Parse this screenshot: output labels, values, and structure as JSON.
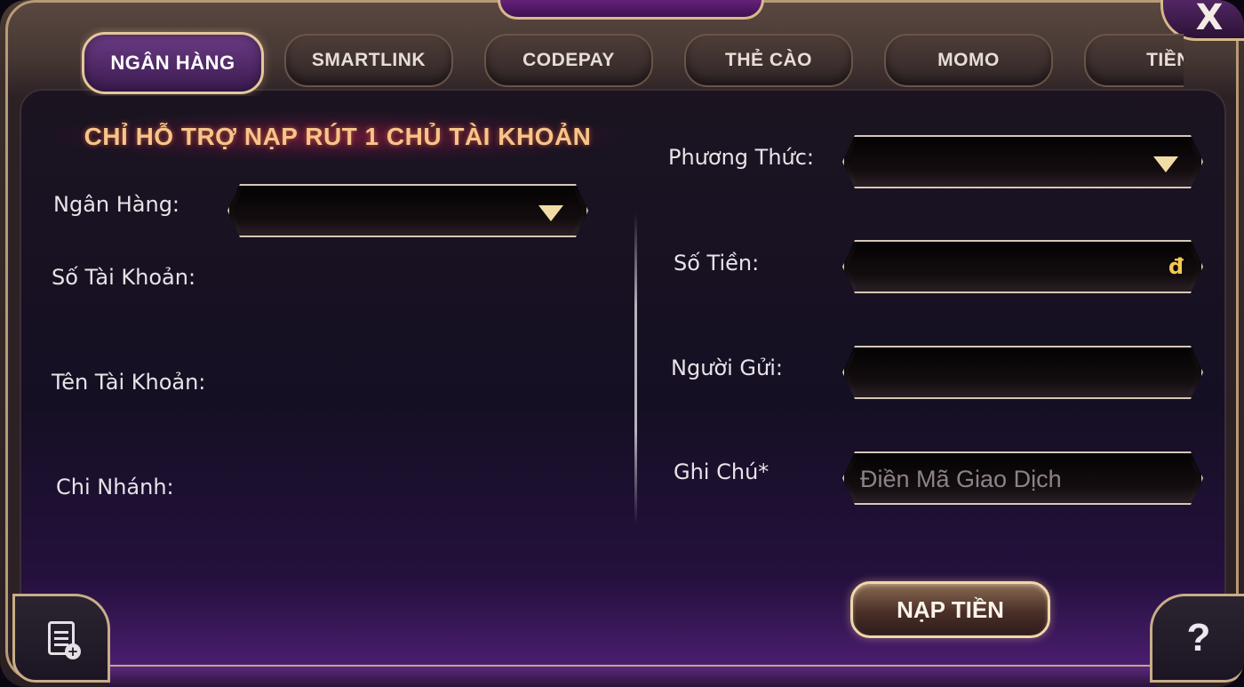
{
  "window": {
    "close_label": "X"
  },
  "tabs": [
    {
      "label": "NGÂN HÀNG",
      "active": true
    },
    {
      "label": "SMARTLINK",
      "active": false
    },
    {
      "label": "CODEPAY",
      "active": false
    },
    {
      "label": "THẺ CÀO",
      "active": false
    },
    {
      "label": "MOMO",
      "active": false
    },
    {
      "label": "TIỀN",
      "active": false
    }
  ],
  "notice": "CHỈ HỖ TRỢ NẠP RÚT 1 CHỦ TÀI KHOẢN",
  "left_form": {
    "bank_label": "Ngân Hàng:",
    "bank_value": "",
    "account_number_label": "Số Tài Khoản:",
    "account_name_label": "Tên Tài Khoản:",
    "branch_label": "Chi Nhánh:"
  },
  "right_form": {
    "method_label": "Phương Thức:",
    "method_value": "",
    "amount_label": "Số Tiền:",
    "amount_currency": "đ",
    "sender_label": "Người Gửi:",
    "note_label": "Ghi Chú*",
    "note_placeholder": "Điền Mã Giao Dịch",
    "note_value": ""
  },
  "actions": {
    "submit_label": "NẠP TIỀN",
    "help_label": "?"
  },
  "icons": {
    "close": "close-icon",
    "dropdown": "chevron-down-icon",
    "history": "history-list-icon",
    "help": "help-icon"
  },
  "colors": {
    "accent_gold": "#e4c79a",
    "notice_text": "#f6c58a",
    "currency": "#f3c94f",
    "active_tab": "#6c3c86"
  }
}
